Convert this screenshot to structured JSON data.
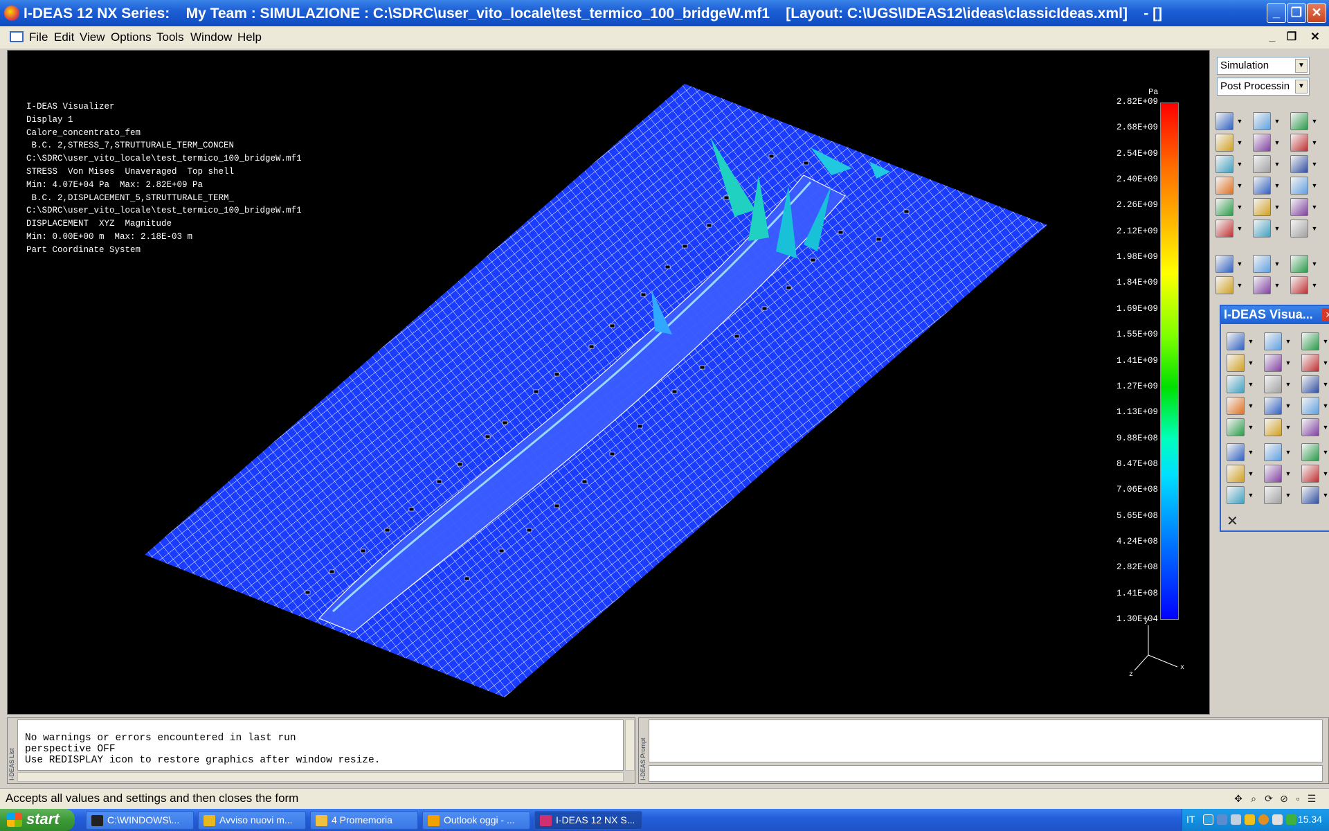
{
  "window": {
    "title": "I-DEAS 12 NX Series:    My Team : SIMULAZIONE : C:\\SDRC\\user_vito_locale\\test_termico_100_bridgeW.mf1    [Layout: C:\\UGS\\IDEAS12\\ideas\\classicIdeas.xml]    - []",
    "minimize_glyph": "_",
    "maximize_glyph": "❐",
    "close_glyph": "✕"
  },
  "menu": [
    "File",
    "Edit",
    "View",
    "Options",
    "Tools",
    "Window",
    "Help"
  ],
  "mdi_controls": {
    "minimize": "_",
    "restore": "❐",
    "close": "✕"
  },
  "viewport": {
    "info_lines": [
      "I-DEAS Visualizer",
      "Display 1",
      "Calore_concentrato_fem",
      " B.C. 2,STRESS_7,STRUTTURALE_TERM_CONCEN",
      "C:\\SDRC\\user_vito_locale\\test_termico_100_bridgeW.mf1",
      "STRESS  Von Mises  Unaveraged  Top shell",
      "Min: 4.07E+04 Pa  Max: 2.82E+09 Pa",
      " B.C. 2,DISPLACEMENT_5,STRUTTURALE_TERM_",
      "C:\\SDRC\\user_vito_locale\\test_termico_100_bridgeW.mf1",
      "DISPLACEMENT  XYZ  Magnitude",
      "Min: 0.00E+00 m  Max: 2.18E-03 m",
      "Part Coordinate System"
    ],
    "scale_unit": "Pa",
    "scale_values": [
      "2.82E+09",
      "2.68E+09",
      "2.54E+09",
      "2.40E+09",
      "2.26E+09",
      "2.12E+09",
      "1.98E+09",
      "1.84E+09",
      "1.69E+09",
      "1.55E+09",
      "1.41E+09",
      "1.27E+09",
      "1.13E+09",
      "9.88E+08",
      "8.47E+08",
      "7.06E+08",
      "5.65E+08",
      "4.24E+08",
      "2.82E+08",
      "1.41E+08",
      "1.30E+04"
    ],
    "triad_labels": {
      "x": "x",
      "y": "y",
      "z": "z"
    },
    "colors": {
      "mesh": "#1a3cff",
      "mesh_line": "#ffffff",
      "peak": "#20d0c0"
    }
  },
  "right_panel": {
    "task_combo": "Simulation",
    "subtask_combo": "Post Processin",
    "combo_arrow": "▼"
  },
  "viz_panel": {
    "title": "I-DEAS Visua...",
    "close_glyph": "x",
    "bottom_icon": "✕"
  },
  "log": {
    "lines": [
      "No warnings or errors encountered in last run",
      "perspective OFF",
      "Use REDISPLAY icon to restore graphics after window resize."
    ],
    "side_tab": "I-DEAS List"
  },
  "prompt": {
    "side_tab": "I-DEAS Prompt"
  },
  "status": {
    "text": "Accepts all values and settings and then closes the form",
    "icons": [
      "✥",
      "⌕",
      "⟳",
      "⊘",
      "▫",
      "☰"
    ]
  },
  "taskbar": {
    "start_label": "start",
    "buttons": [
      {
        "label": "C:\\WINDOWS\\...",
        "color": "#222222"
      },
      {
        "label": "Avviso nuovi m...",
        "color": "#e8b820"
      },
      {
        "label": "4 Promemoria",
        "color": "#f0c040"
      },
      {
        "label": "Outlook oggi - ...",
        "color": "#f0a000"
      },
      {
        "label": "I-DEAS 12 NX S...",
        "color": "#d03070"
      }
    ],
    "language": "IT",
    "clock": "15.34"
  }
}
